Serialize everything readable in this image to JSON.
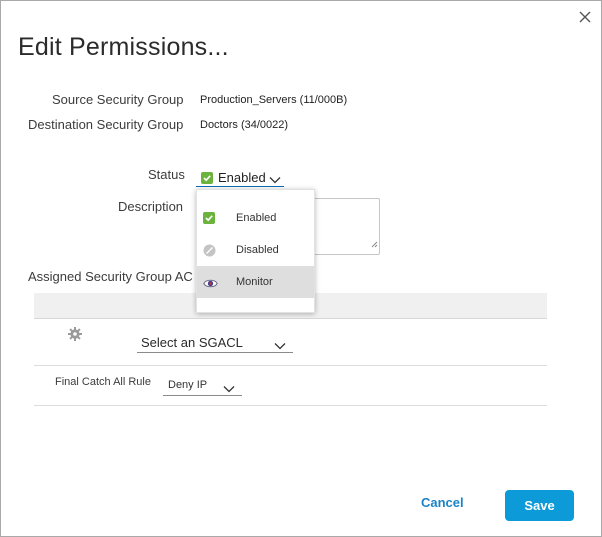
{
  "dialog": {
    "title": "Edit Permissions...",
    "close_icon": "close-icon"
  },
  "fields": {
    "source_label": "Source Security Group",
    "source_value": "Production_Servers (11/000B)",
    "destination_label": "Destination Security Group",
    "destination_value": "Doctors (34/0022)",
    "status_label": "Status",
    "status_value": "Enabled",
    "description_label": "Description",
    "description_value": "",
    "assigned_label": "Assigned Security Group AC"
  },
  "status_menu": {
    "items": [
      {
        "label": "Enabled",
        "icon": "checkbox-checked-icon"
      },
      {
        "label": "Disabled",
        "icon": "disabled-circle-icon"
      },
      {
        "label": "Monitor",
        "icon": "eye-icon",
        "highlighted": true
      }
    ]
  },
  "sgacl": {
    "select_value": "Select an SGACL",
    "icon": "gear-icon"
  },
  "catch_all": {
    "label": "Final Catch All Rule",
    "value": "Deny IP"
  },
  "footer": {
    "cancel_label": "Cancel",
    "save_label": "Save"
  },
  "colors": {
    "accent": "#0d9ad8",
    "link": "#1c84c6",
    "check_green": "#6cb33e",
    "underline_active": "#0d6eb8"
  }
}
